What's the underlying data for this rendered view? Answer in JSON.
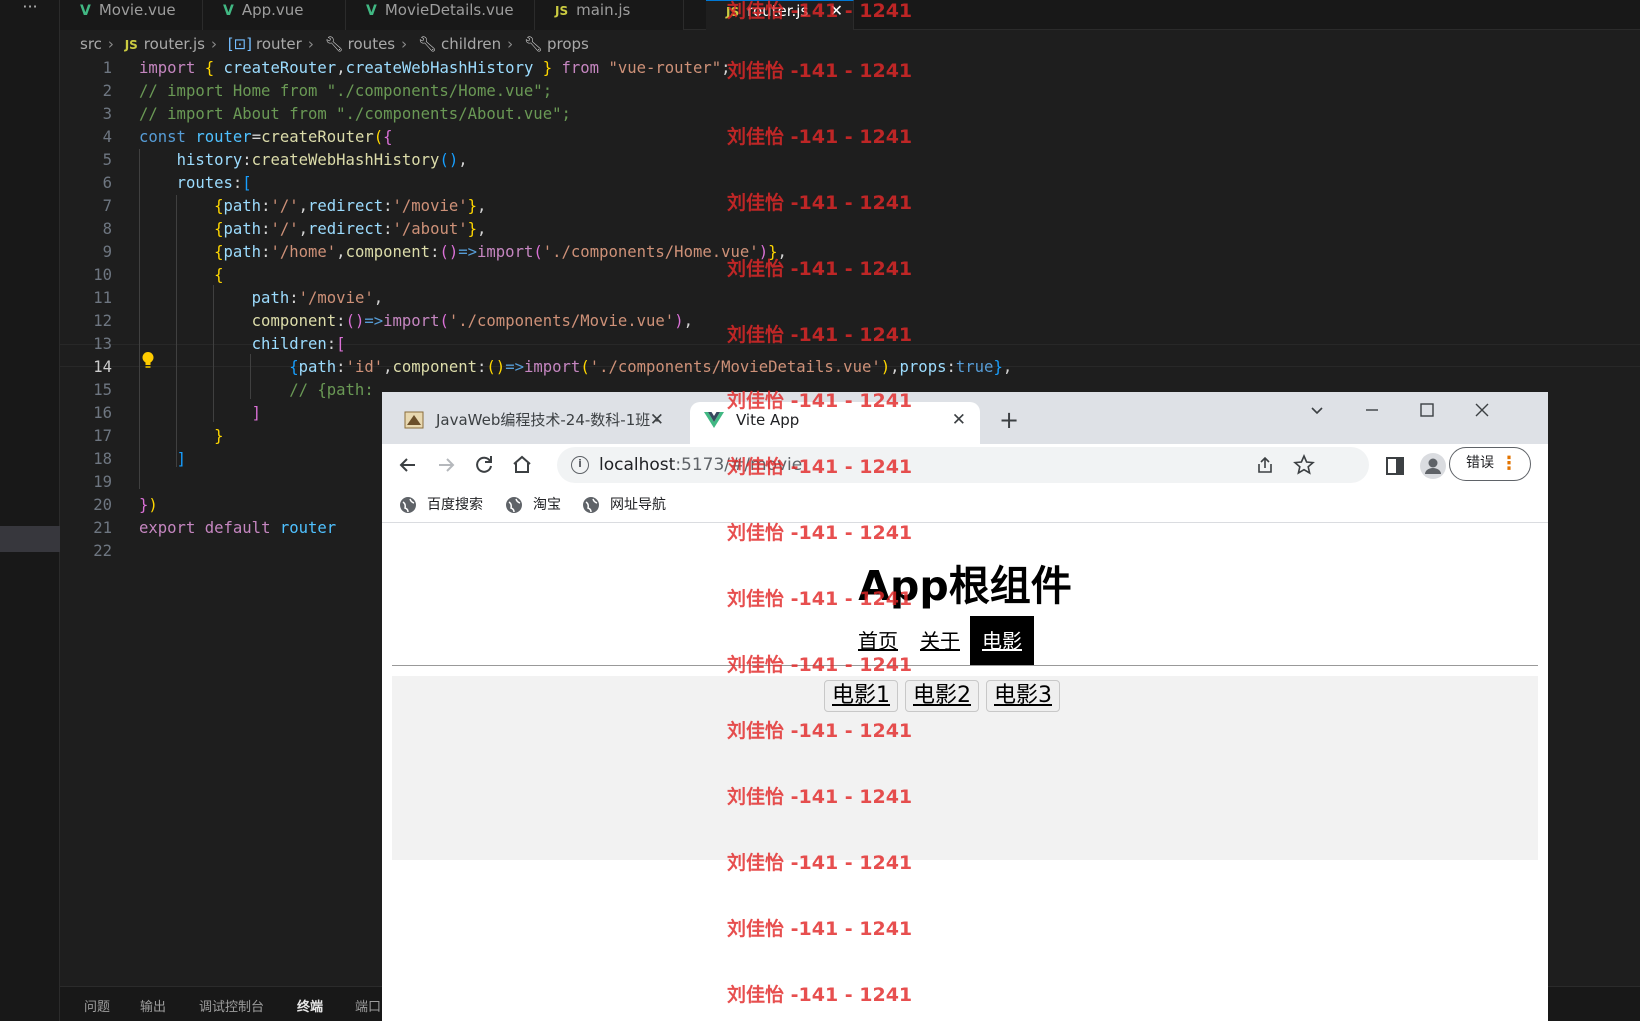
{
  "editor": {
    "more_label": "···",
    "tabs": [
      {
        "label": "Movie.vue",
        "icon": "vue-icon"
      },
      {
        "label": "App.vue",
        "icon": "vue-icon"
      },
      {
        "label": "MovieDetails.vue",
        "icon": "vue-icon"
      },
      {
        "label": "main.js",
        "icon": "js-icon"
      },
      {
        "label": "router.js",
        "icon": "js-icon",
        "active": true
      }
    ],
    "tab_close": "✕",
    "breadcrumb": {
      "folder": "src",
      "file": "router.js",
      "symbol1": "router",
      "symbol2": "routes",
      "symbol3": "children",
      "symbol4": "props"
    },
    "line_numbers": [
      "1",
      "2",
      "3",
      "4",
      "5",
      "6",
      "7",
      "8",
      "9",
      "10",
      "11",
      "12",
      "13",
      "14",
      "15",
      "16",
      "17",
      "18",
      "19",
      "20",
      "21",
      "22"
    ],
    "current_line": "14",
    "panel_tabs": [
      "问题",
      "输出",
      "调试控制台",
      "终端",
      "端口"
    ]
  },
  "browser": {
    "tabs": [
      {
        "title": "JavaWeb编程技术-24-数科-1班 -"
      },
      {
        "title": "Vite App"
      }
    ],
    "close_glyph": "✕",
    "new_tab": "+",
    "url_host": "localhost",
    "url_rest": ":5173/#/movie",
    "error_button": "错误",
    "bookmarks": [
      "百度搜索",
      "淘宝",
      "网址导航"
    ],
    "page": {
      "title": "App根组件",
      "nav": [
        "首页",
        "关于",
        "电影"
      ],
      "active_nav": "电影",
      "sub_nav": [
        "电影1",
        "电影2",
        "电影3"
      ]
    }
  },
  "watermark": "刘佳怡 -141 - 1241",
  "colors": {
    "editor_bg": "#1e1e1e",
    "keyword": "#c586c0",
    "string": "#ce9178",
    "comment": "#6a9955",
    "variable": "#9cdcfe",
    "function": "#dcdcaa",
    "watermark": "#e22828",
    "vue_green": "#41b883"
  }
}
